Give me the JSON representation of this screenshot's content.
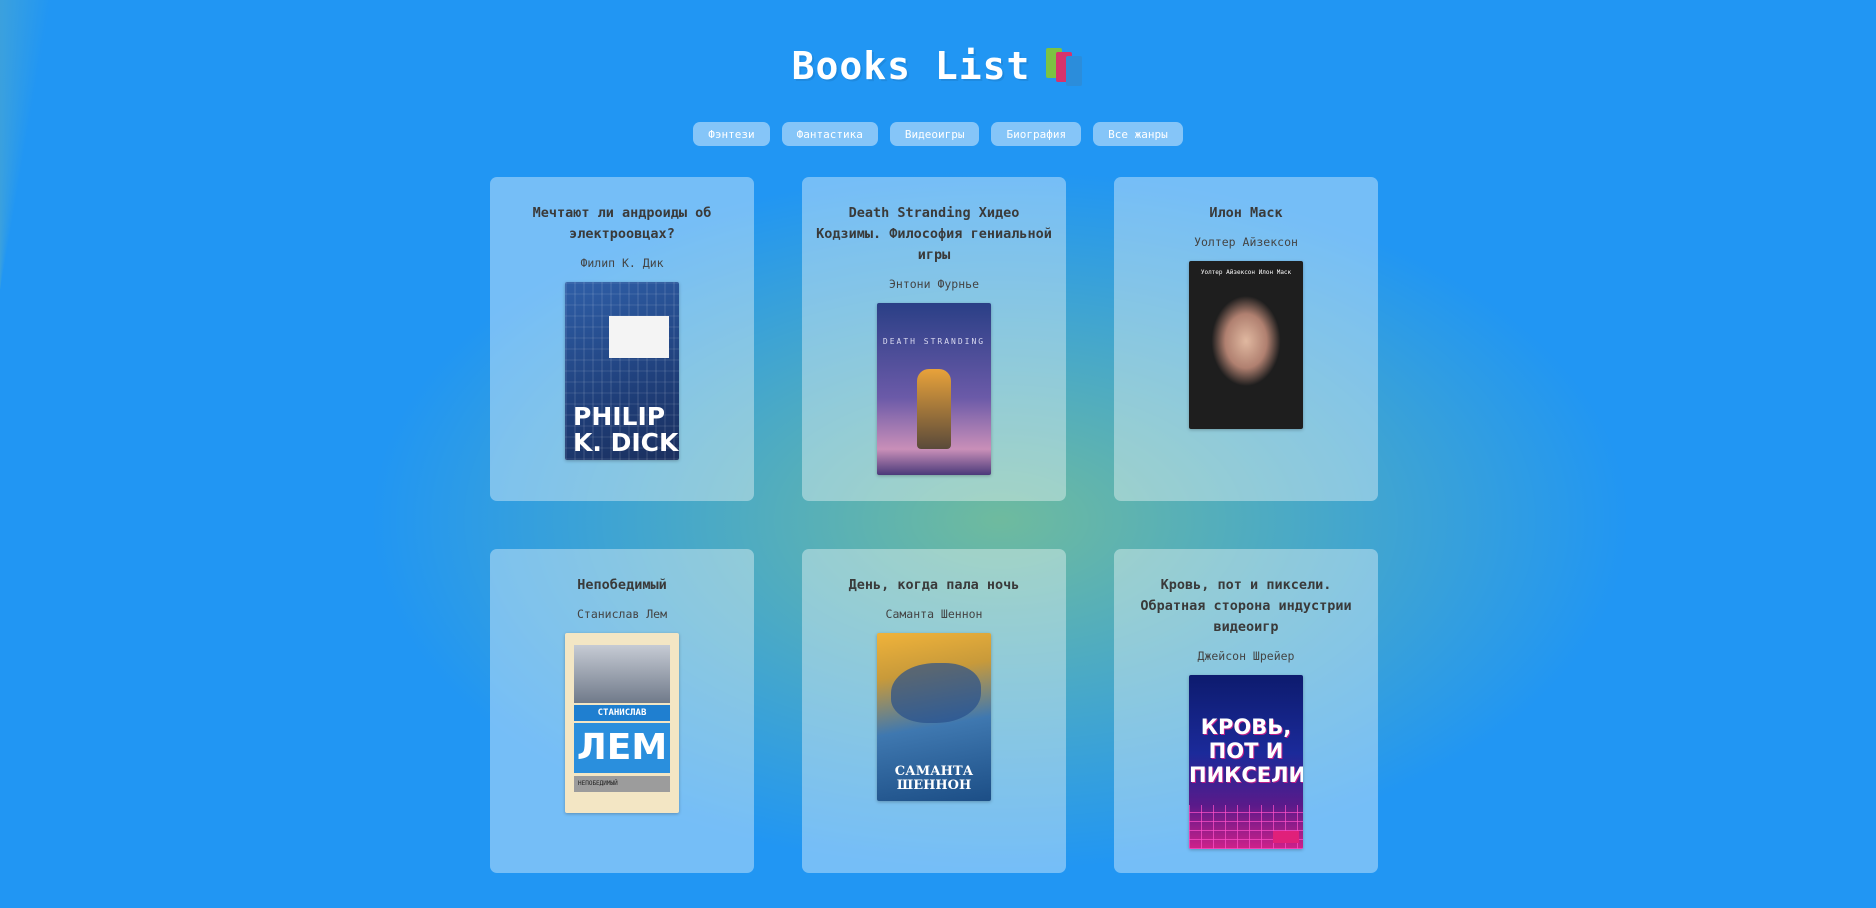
{
  "header": {
    "title": "Books List",
    "icon": "books-icon"
  },
  "filters": [
    {
      "label": "Фэнтези"
    },
    {
      "label": "Фантастика"
    },
    {
      "label": "Видеоигры"
    },
    {
      "label": "Биография"
    },
    {
      "label": "Все жанры"
    }
  ],
  "books": [
    {
      "title": "Мечтают ли андроиды об электроовцах?",
      "author": "Филип К. Дик",
      "cover_text": "PHILIP K. DICK"
    },
    {
      "title": "Death Stranding Хидео Кодзимы. Философия гениальной игры",
      "author": "Энтони Фурнье",
      "cover_text": "DEATH STRANDING"
    },
    {
      "title": "Илон Маск",
      "author": "Уолтер Айзексон",
      "cover_text": "Уолтер Айзексон Илон Маск"
    },
    {
      "title": "Непобедимый",
      "author": "Станислав Лем",
      "cover_text": "ЛЕМ",
      "cover_name": "СТАНИСЛАВ",
      "cover_sub": "НЕПОБЕДИМЫЙ"
    },
    {
      "title": "День, когда пала ночь",
      "author": "Саманта Шеннон",
      "cover_text": "САМАНТА ШЕННОН"
    },
    {
      "title": "Кровь, пот и пиксели. Обратная сторона индустрии видеоигр",
      "author": "Джейсон Шрейер",
      "cover_text": "КРОВЬ, ПОТ И ПИКСЕЛИ"
    }
  ],
  "colors": {
    "background_red": "#ff1a00",
    "background_orange": "#ff8c00",
    "background_yellow": "#ffff00",
    "background_blue": "#2196f3"
  }
}
